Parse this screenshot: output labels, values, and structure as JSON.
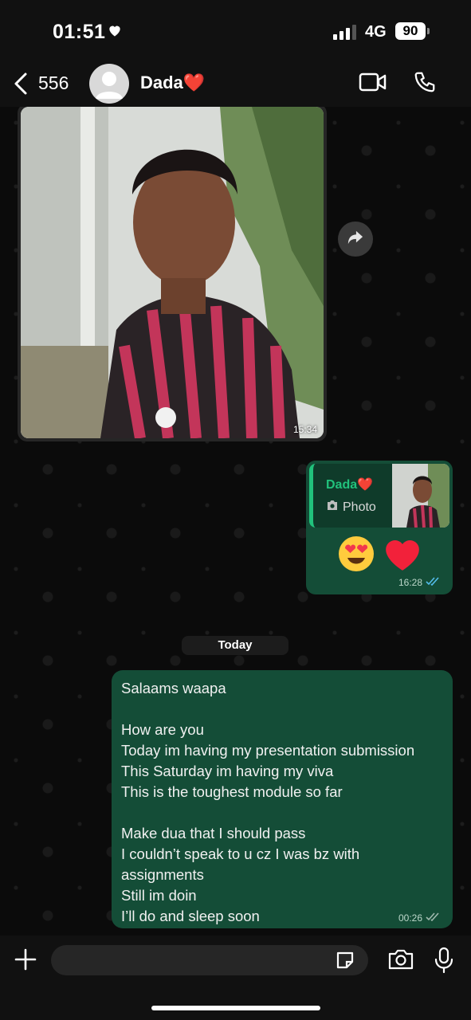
{
  "status_bar": {
    "time": "01:51",
    "network": "4G",
    "battery": "90"
  },
  "header": {
    "back_count": "556",
    "contact_name": "Dada❤️"
  },
  "messages": {
    "image_message": {
      "time": "15:34"
    },
    "reply_message": {
      "quoted_name": "Dada❤️",
      "quoted_type": "Photo",
      "emojis": "😍 ❤️",
      "time": "16:28"
    },
    "date_divider": "Today",
    "text_message": {
      "lines": [
        "Salaams waapa",
        "",
        "How are you",
        "Today im having my presentation submission",
        "This Saturday im having my viva",
        "This is the toughest module so far",
        "",
        "Make dua that I should pass",
        "I couldn’t speak to u cz I was bz with",
        "assignments",
        "Still im doin",
        "I’ll do and sleep soon"
      ],
      "time": "00:26"
    }
  },
  "colors": {
    "bubble_out": "#144d37",
    "accent": "#21c27c",
    "read_tick": "#53bdeb"
  }
}
